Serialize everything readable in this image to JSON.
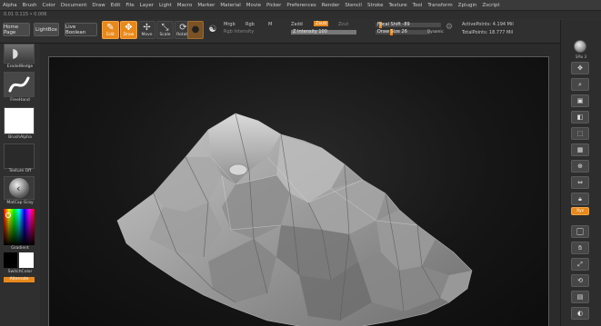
{
  "menu": [
    "Alpha",
    "Brush",
    "Color",
    "Document",
    "Draw",
    "Edit",
    "File",
    "Layer",
    "Light",
    "Macro",
    "Marker",
    "Material",
    "Movie",
    "Picker",
    "Preferences",
    "Render",
    "Stencil",
    "Stroke",
    "Texture",
    "Tool",
    "Transform",
    "Zplugin",
    "Zscript"
  ],
  "subbar_text": "0.01 0.115 • 0.006",
  "toolbar": {
    "home_page": "Home Page",
    "lightbox": "LightBox",
    "live_boolean": "Live Boolean",
    "edit": "Edit",
    "draw": "Draw",
    "move": "Move",
    "scale": "Scale",
    "rotate": "Rotate",
    "mrgb": "Mrgb",
    "rgb": "Rgb",
    "m": "M",
    "rgb_intensity": "Rgb Intensity",
    "zadd": "Zadd",
    "zsub": "Zsub",
    "zcut": "Zcut",
    "z_intensity_label": "Z Intensity",
    "z_intensity_value": "100",
    "focal_shift_label": "Focal Shift",
    "focal_shift_value": "-89",
    "draw_size_label": "Draw Size",
    "draw_size_value": "26",
    "dynamic": "Dynamic",
    "active_points": "ActivePoints: 4.194 Mil",
    "total_points": "TotalPoints: 18.777 Mil"
  },
  "left": {
    "brush_label": "ErodeWedge",
    "stroke_label": "FreeHand",
    "alpha_label": "BrushAlpha",
    "texture_label": "Texture Off",
    "material_label": "MatCap Gray",
    "gradient_label": "Gradient",
    "switch_label": "SwitchColor",
    "alternate_label": "Alternate"
  },
  "right": {
    "bpr": "BPR",
    "spix": "SPix 3",
    "scroll": "Scroll",
    "zoom": "Zoom",
    "actual": "Actual",
    "aahalf": "AAHalf",
    "persp": "Persp",
    "floor": "Floor",
    "local": "Local",
    "lsym": "L.Sym",
    "xyz": "Xyz",
    "frame": "Frame",
    "move": "Move",
    "scale": "Scale",
    "rotate": "Rotate",
    "linefill": "Line Fill",
    "transp": "Transp"
  },
  "colors": {
    "accent": "#e8891c",
    "canvas_bg": "#111111"
  },
  "sliders": {
    "z_intensity": 1.0,
    "focal_shift": 0.055,
    "draw_size": 0.26,
    "rgb_intensity": 0.0
  }
}
